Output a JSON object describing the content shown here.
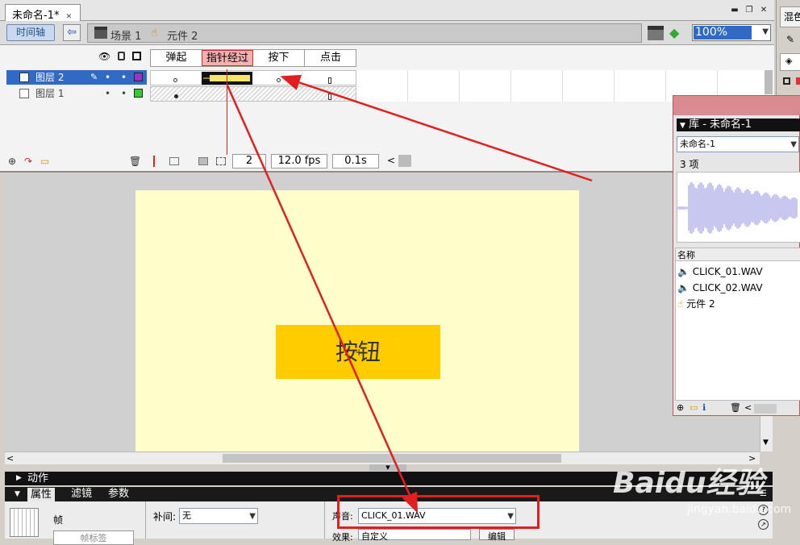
{
  "document": {
    "tab_title": "未命名-1*"
  },
  "toolbar": {
    "timeline_label": "时间轴",
    "breadcrumbs": [
      "场景 1",
      "元件 2"
    ],
    "zoom": "100%"
  },
  "timeline": {
    "states": [
      "弹起",
      "指针经过",
      "按下",
      "点击"
    ],
    "layers": [
      {
        "name": "图层 2",
        "color": "#9933cc"
      },
      {
        "name": "图层 1",
        "color": "#33cc33"
      }
    ],
    "current_frame": "2",
    "fps": "12.0 fps",
    "elapsed": "0.1s"
  },
  "stage": {
    "button_text": "按钮"
  },
  "panels": {
    "actions": "动作",
    "properties_tab": "属性",
    "filters_tab": "滤镜",
    "params_tab": "参数"
  },
  "properties": {
    "frame_label": "帧",
    "tween_label": "补间:",
    "tween_value": "无",
    "sound_label": "声音:",
    "sound_value": "CLICK_01.WAV",
    "effect_label": "效果:",
    "effect_value": "自定义",
    "edit_button": "编辑",
    "frame_label_button": "帧标签"
  },
  "library": {
    "title": "库 - 未命名-1",
    "doc_select": "未命名-1",
    "count": "3 项",
    "name_header": "名称",
    "items": [
      {
        "name": "CLICK_01.WAV",
        "icon": "sound-icon"
      },
      {
        "name": "CLICK_02.WAV",
        "icon": "sound-icon"
      },
      {
        "name": "元件 2",
        "icon": "button-symbol-icon"
      }
    ]
  },
  "right_panel": {
    "label": "混色"
  },
  "watermark": {
    "brand": "Baidu经验",
    "url": "jingyan.baidu.com"
  },
  "colors": {
    "accent": "#316ac5",
    "annotation_red": "#e02020",
    "stage_bg": "#ffffcc",
    "button_fill": "#ffcc00"
  }
}
